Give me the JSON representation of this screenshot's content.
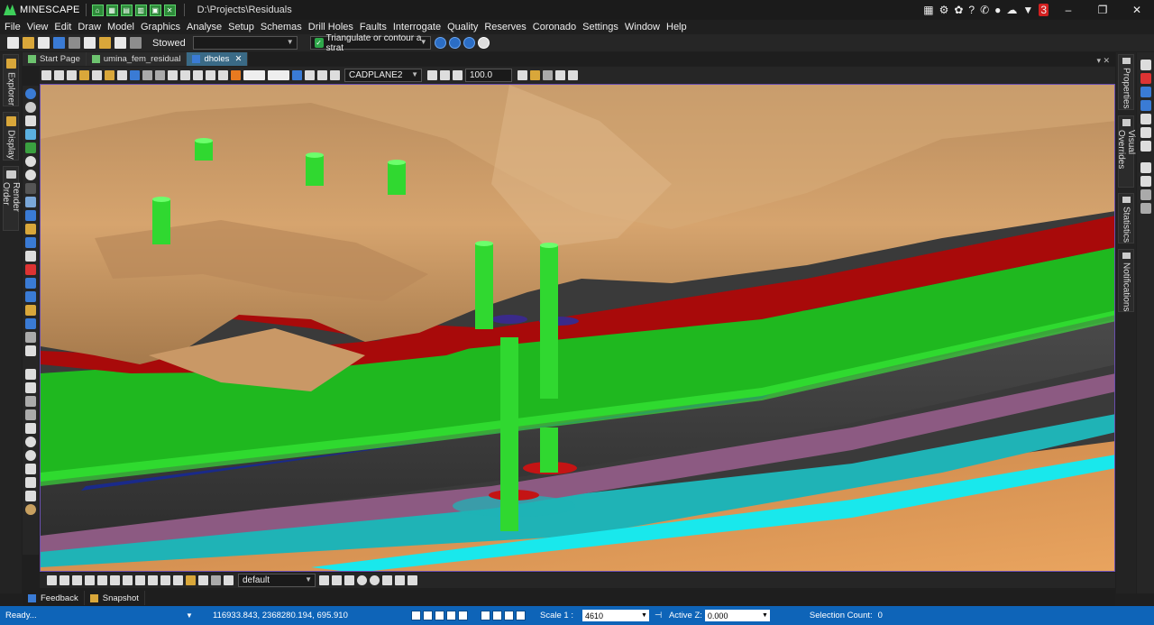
{
  "app": {
    "name": "MINESCAPE",
    "path": "D:\\Projects\\Residuals",
    "notification_count": "3"
  },
  "menu": [
    "File",
    "View",
    "Edit",
    "Draw",
    "Model",
    "Graphics",
    "Analyse",
    "Setup",
    "Schemas",
    "Drill Holes",
    "Faults",
    "Interrogate",
    "Quality",
    "Reserves",
    "Coronado",
    "Settings",
    "Window",
    "Help"
  ],
  "toolbar1": {
    "stowed_label": "Stowed",
    "stowed_combo_value": "",
    "triangulate_label": "Triangulate or contour a strat"
  },
  "tabs": [
    {
      "label": "Start Page"
    },
    {
      "label": "umina_fem_residual"
    },
    {
      "label": "dholes"
    }
  ],
  "toolbar2": {
    "plane_value": "CADPLANE2",
    "scale_value": "100.0"
  },
  "left_dock": [
    "Explorer",
    "Display",
    "Render Order"
  ],
  "right_dock": [
    "Properties",
    "Visual Overrides",
    "Statistics",
    "Notifications"
  ],
  "toolbar3": {
    "layer_value": "default"
  },
  "bottom_tabs": [
    {
      "label": "Feedback"
    },
    {
      "label": "Snapshot"
    }
  ],
  "status": {
    "message": "Ready...",
    "coords": "116933.843,  2368280.194,  695.910",
    "scale_label": "Scale 1 :",
    "scale_value": "4610",
    "active_z_label": "Active Z:",
    "active_z_value": "0.000",
    "selection_label": "Selection Count:",
    "selection_value": "0"
  },
  "colors": {
    "terrain": "#c9975f",
    "red_seam": "#a80a0a",
    "green_seam": "#1fb81f",
    "cyan_seam": "#19d6d9",
    "magenta_seam": "#9a5a8a",
    "drillhole": "#3cf03c",
    "status_bar": "#0e64b8"
  }
}
